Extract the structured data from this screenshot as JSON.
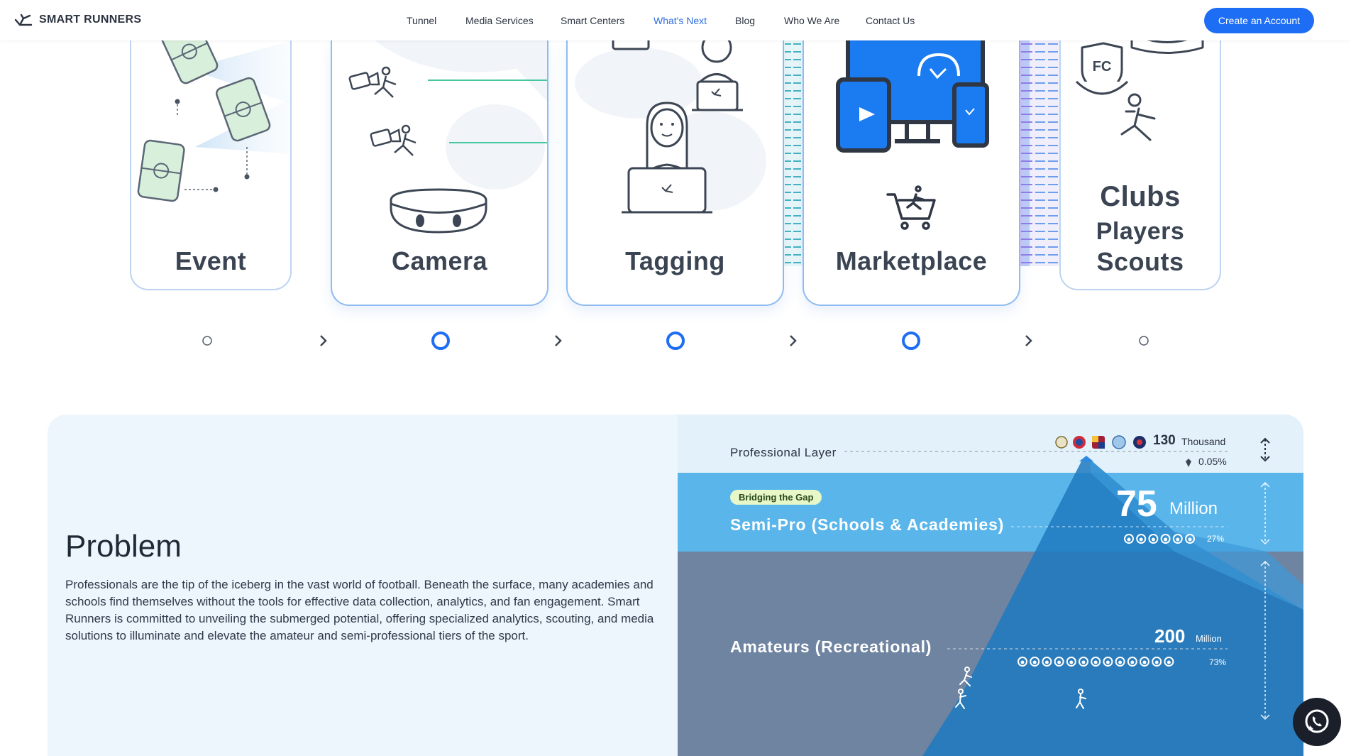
{
  "header": {
    "brand": "SMART RUNNERS",
    "nav": [
      {
        "label": "Tunnel",
        "active": false
      },
      {
        "label": "Media Services",
        "active": false
      },
      {
        "label": "Smart Centers",
        "active": false
      },
      {
        "label": "What's Next",
        "active": true
      },
      {
        "label": "Blog",
        "active": false
      },
      {
        "label": "Who We Are",
        "active": false
      },
      {
        "label": "Contact Us",
        "active": false
      }
    ],
    "cta": "Create an Account"
  },
  "pipeline": {
    "cards": [
      {
        "label": "Event",
        "icon": "football-pitch-icon"
      },
      {
        "label": "Camera",
        "icon": "camera-icon"
      },
      {
        "label": "Tagging",
        "icon": "tagger-at-laptop-icon"
      },
      {
        "label": "Marketplace",
        "icon": "shopping-cart-icon"
      },
      {
        "label_lines": [
          "Clubs",
          "Players",
          "Scouts"
        ],
        "icon": "fc-badge-icon"
      }
    ],
    "fc_badge_text": "FC"
  },
  "problem": {
    "title": "Problem",
    "body": "Professionals are the tip of the iceberg in the vast world of football. Beneath the surface, many academies and schools find themselves without the tools for effective data collection, analytics, and fan engagement. Smart Runners is committed to unveiling the submerged potential, offering specialized analytics, scouting, and media solutions to illuminate and elevate the amateur and semi-professional tiers of the sport."
  },
  "iceberg": {
    "professional": {
      "name": "Professional Layer",
      "count": "130",
      "unit": "Thousand",
      "percent": "0.05%"
    },
    "semipro": {
      "badge": "Bridging the Gap",
      "name": "Semi-Pro (Schools & Academies)",
      "count": "75",
      "unit": "Million",
      "percent": "27%"
    },
    "amateur": {
      "name": "Amateurs (Recreational)",
      "count": "200",
      "unit": "Million",
      "percent": "73%"
    },
    "colors": {
      "top": "#e3f1fb",
      "semipro": "#5ab5ea",
      "amateur": "#6f84a1",
      "peak": "#1f79bf"
    }
  }
}
